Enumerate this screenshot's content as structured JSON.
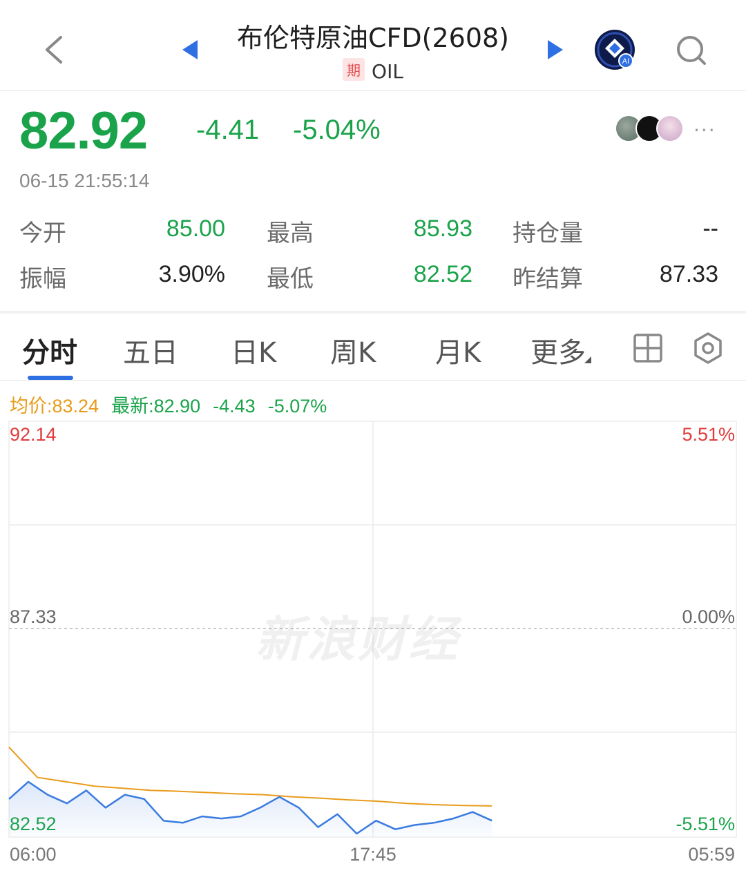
{
  "header": {
    "title": "布伦特原油CFD(2608)",
    "badge": "期",
    "symbol": "OIL",
    "icons": [
      "back-chevron-icon",
      "prev-triangle-icon",
      "next-triangle-icon",
      "ai-assistant-icon",
      "search-icon"
    ]
  },
  "quote": {
    "price": "82.92",
    "change": "-4.41",
    "change_pct": "-5.04%",
    "timestamp": "06-15 21:55:14",
    "more": "···"
  },
  "stats": [
    {
      "label": "今开",
      "value": "85.00"
    },
    {
      "label": "最高",
      "value": "85.93"
    },
    {
      "label": "持仓量",
      "value": "--"
    },
    {
      "label": "振幅",
      "value": "3.90%"
    },
    {
      "label": "最低",
      "value": "82.52"
    },
    {
      "label": "昨结算",
      "value": "87.33"
    }
  ],
  "tabs": [
    "分时",
    "五日",
    "日K",
    "周K",
    "月K",
    "更多"
  ],
  "info": {
    "avg": "均价:83.24",
    "latest": "最新:82.90",
    "change": "-4.43",
    "pct": "-5.07%"
  },
  "watermark": "新浪财经",
  "colors": {
    "up": "#e03c3c",
    "down": "#1aa34a",
    "avg_line": "#e89b1a",
    "price_line": "#3a7be0",
    "accent": "#2f6fe4"
  },
  "chart_data": {
    "type": "line",
    "y_left_ticks": [
      "92.14",
      "87.33",
      "82.52"
    ],
    "y_right_ticks": [
      "5.51%",
      "0.00%",
      "-5.51%"
    ],
    "x_ticks": [
      "06:00",
      "17:45",
      "05:59"
    ],
    "ylim": [
      82.52,
      92.14
    ],
    "reference": 87.33,
    "x_fraction_end": 0.664,
    "series": [
      {
        "name": "均价",
        "values": [
          84.6,
          83.9,
          83.8,
          83.7,
          83.65,
          83.6,
          83.58,
          83.55,
          83.52,
          83.5,
          83.45,
          83.42,
          83.38,
          83.35,
          83.3,
          83.27,
          83.25,
          83.24
        ]
      },
      {
        "name": "最新",
        "values": [
          83.4,
          83.8,
          83.5,
          83.3,
          83.6,
          83.2,
          83.5,
          83.4,
          82.9,
          82.85,
          83.0,
          82.95,
          83.0,
          83.2,
          83.45,
          83.2,
          82.75,
          83.05,
          82.6,
          82.9,
          82.7,
          82.8,
          82.85,
          82.95,
          83.1,
          82.9
        ]
      }
    ]
  }
}
